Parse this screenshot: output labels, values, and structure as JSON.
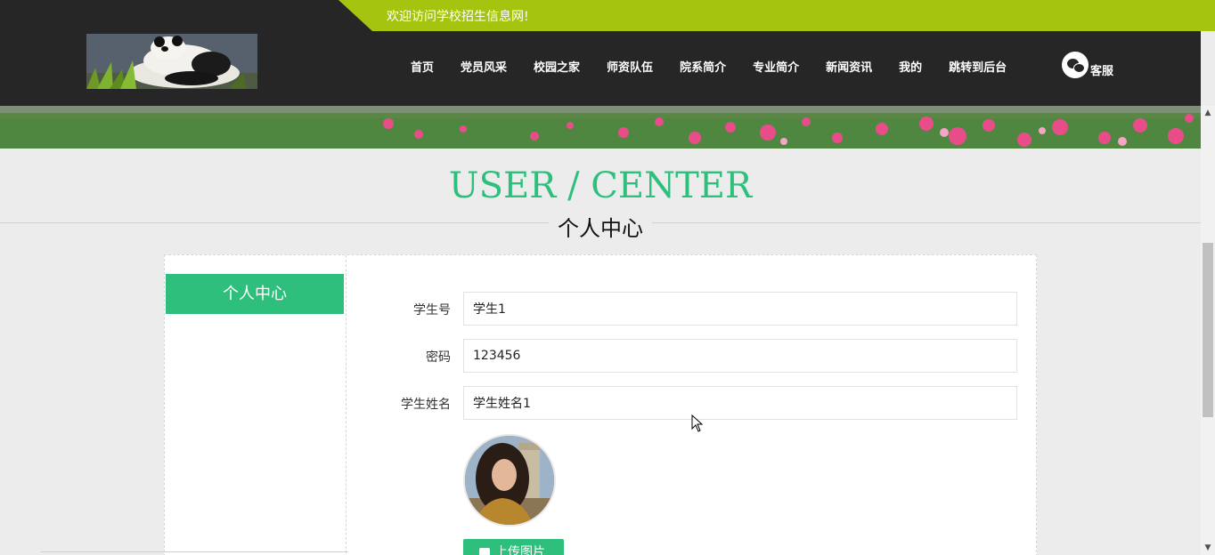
{
  "topbar": {
    "welcome": "欢迎访问学校招生信息网!"
  },
  "nav": {
    "items": [
      "首页",
      "党员风采",
      "校园之家",
      "师资队伍",
      "院系简介",
      "专业简介",
      "新闻资讯",
      "我的",
      "跳转到后台"
    ],
    "service_label": "客服"
  },
  "page": {
    "title_en": "USER / CENTER",
    "title_cn": "个人中心"
  },
  "sidebar": {
    "active_label": "个人中心"
  },
  "form": {
    "student_no_label": "学生号",
    "student_no_value": "学生1",
    "password_label": "密码",
    "password_value": "123456",
    "name_label": "学生姓名",
    "name_value": "学生姓名1",
    "upload_label": "上传图片"
  },
  "colors": {
    "accent": "#2fbf7c",
    "topbar_green": "#a5c40f",
    "header_bg": "#262626"
  }
}
